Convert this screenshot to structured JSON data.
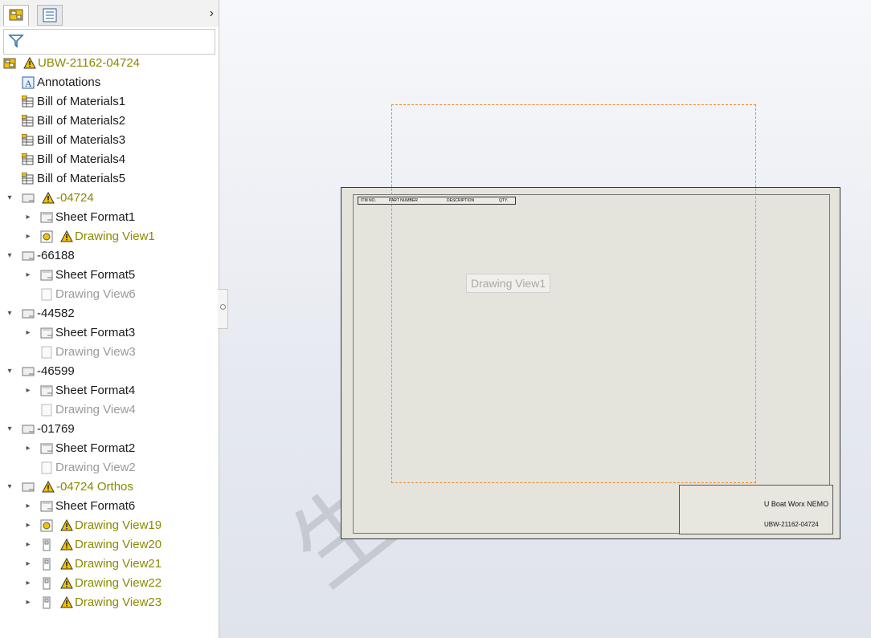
{
  "panel": {
    "filter_icon": "filter-icon",
    "tree": [
      {
        "label": "UBW-21162-04724",
        "warn": true,
        "style": "warn",
        "icon": "drawing-icon",
        "indent": 0,
        "arrow": ""
      },
      {
        "label": "Annotations",
        "warn": false,
        "style": "",
        "icon": "annotations-icon",
        "indent": 1,
        "arrow": ""
      },
      {
        "label": "Bill of Materials1",
        "warn": false,
        "style": "",
        "icon": "bom-icon",
        "indent": 1,
        "arrow": ""
      },
      {
        "label": "Bill of Materials2",
        "warn": false,
        "style": "",
        "icon": "bom-icon",
        "indent": 1,
        "arrow": ""
      },
      {
        "label": "Bill of Materials3",
        "warn": false,
        "style": "",
        "icon": "bom-icon",
        "indent": 1,
        "arrow": ""
      },
      {
        "label": "Bill of Materials4",
        "warn": false,
        "style": "",
        "icon": "bom-icon",
        "indent": 1,
        "arrow": ""
      },
      {
        "label": "Bill of Materials5",
        "warn": false,
        "style": "",
        "icon": "bom-icon",
        "indent": 1,
        "arrow": ""
      },
      {
        "label": "-04724",
        "warn": true,
        "style": "warn",
        "icon": "sheet-icon",
        "indent": 1,
        "arrow": "down"
      },
      {
        "label": "Sheet Format1",
        "warn": false,
        "style": "",
        "icon": "sheet-format-icon",
        "indent": 2,
        "arrow": "right"
      },
      {
        "label": "Drawing View1",
        "warn": true,
        "style": "warn",
        "icon": "view-icon",
        "indent": 2,
        "arrow": "right"
      },
      {
        "label": "-66188",
        "warn": false,
        "style": "",
        "icon": "sheet-icon",
        "indent": 1,
        "arrow": "down"
      },
      {
        "label": "Sheet Format5",
        "warn": false,
        "style": "",
        "icon": "sheet-format-icon",
        "indent": 2,
        "arrow": "right"
      },
      {
        "label": "Drawing View6",
        "warn": false,
        "style": "dim",
        "icon": "empty-view-icon",
        "indent": 2,
        "arrow": ""
      },
      {
        "label": "-44582",
        "warn": false,
        "style": "",
        "icon": "sheet-icon",
        "indent": 1,
        "arrow": "down"
      },
      {
        "label": "Sheet Format3",
        "warn": false,
        "style": "",
        "icon": "sheet-format-icon",
        "indent": 2,
        "arrow": "right"
      },
      {
        "label": "Drawing View3",
        "warn": false,
        "style": "dim",
        "icon": "empty-view-icon",
        "indent": 2,
        "arrow": ""
      },
      {
        "label": "-46599",
        "warn": false,
        "style": "",
        "icon": "sheet-icon",
        "indent": 1,
        "arrow": "down"
      },
      {
        "label": "Sheet Format4",
        "warn": false,
        "style": "",
        "icon": "sheet-format-icon",
        "indent": 2,
        "arrow": "right"
      },
      {
        "label": "Drawing View4",
        "warn": false,
        "style": "dim",
        "icon": "empty-view-icon",
        "indent": 2,
        "arrow": ""
      },
      {
        "label": "-01769",
        "warn": false,
        "style": "",
        "icon": "sheet-icon",
        "indent": 1,
        "arrow": "down"
      },
      {
        "label": "Sheet Format2",
        "warn": false,
        "style": "",
        "icon": "sheet-format-icon",
        "indent": 2,
        "arrow": "right"
      },
      {
        "label": "Drawing View2",
        "warn": false,
        "style": "dim",
        "icon": "empty-view-icon",
        "indent": 2,
        "arrow": ""
      },
      {
        "label": "-04724 Orthos",
        "warn": true,
        "style": "warn",
        "icon": "sheet-icon",
        "indent": 1,
        "arrow": "down"
      },
      {
        "label": "Sheet Format6",
        "warn": false,
        "style": "",
        "icon": "sheet-format-icon",
        "indent": 2,
        "arrow": "right"
      },
      {
        "label": "Drawing View19",
        "warn": true,
        "style": "warn",
        "icon": "view-icon",
        "indent": 2,
        "arrow": "right"
      },
      {
        "label": "Drawing View20",
        "warn": true,
        "style": "warn",
        "icon": "ortho-view-icon",
        "indent": 2,
        "arrow": "right"
      },
      {
        "label": "Drawing View21",
        "warn": true,
        "style": "warn",
        "icon": "ortho-view-icon",
        "indent": 2,
        "arrow": "right"
      },
      {
        "label": "Drawing View22",
        "warn": true,
        "style": "warn",
        "icon": "ortho-view-icon",
        "indent": 2,
        "arrow": "right"
      },
      {
        "label": "Drawing View23",
        "warn": true,
        "style": "warn",
        "icon": "ortho-view-icon",
        "indent": 2,
        "arrow": "right"
      }
    ]
  },
  "canvas": {
    "view_label": "Drawing View1",
    "bom_header": [
      "ITM NO.",
      "PART NUMBER",
      "DESCRIPTION",
      "QTY."
    ],
    "title_company": "U Boat Worx NEMO",
    "title_number": "UBW-21162-04724",
    "watermark": "生信科技"
  },
  "colors": {
    "warn_text": "#8a8a00",
    "dim_text": "#9a9a9a",
    "view_box": "#f08a2a"
  }
}
